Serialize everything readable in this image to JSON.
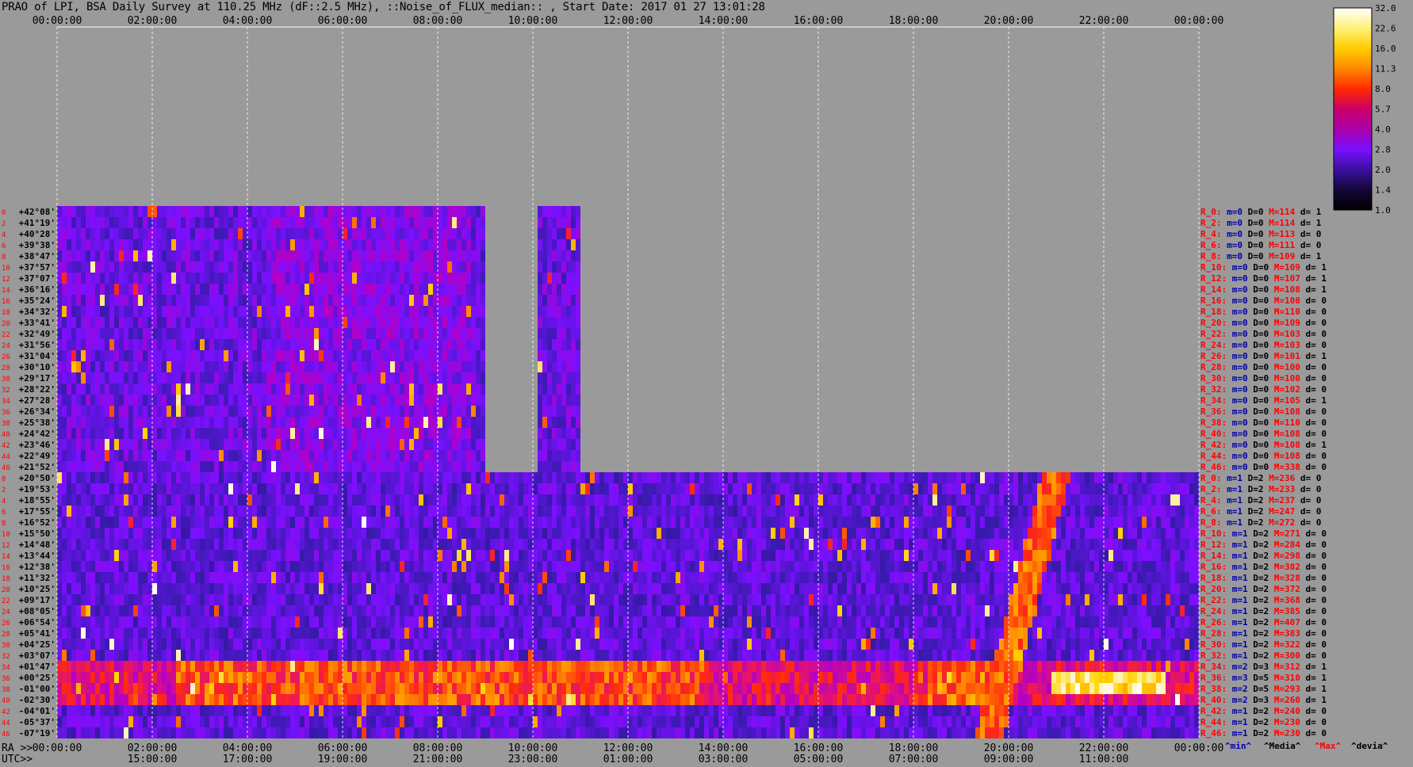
{
  "header": {
    "title": "PRAO of LPI, BSA Daily Survey at 110.25 MHz (dF::2.5 MHz), ::Noise_of_FLUX_median:: , Start Date: 2017 01 27 13:01:28"
  },
  "colorbar": {
    "ticks": [
      "32.0",
      "22.6",
      "16.0",
      "11.3",
      "8.0",
      "5.7",
      "4.0",
      "2.8",
      "2.0",
      "1.4",
      "1.0"
    ],
    "colors": [
      "#ffffff",
      "#fff27a",
      "#ffcc00",
      "#ff8800",
      "#ff2a00",
      "#cc0066",
      "#aa00aa",
      "#7a10ff",
      "#3a10a0",
      "#140638",
      "#000000"
    ]
  },
  "axis_labels": {
    "ra_prefix": "RA >>",
    "utc_prefix": "UTC>>",
    "legend_min": "^min^",
    "legend_media": "^Media^",
    "legend_max": "^Max^",
    "legend_devia": "^devia^"
  },
  "chart_data": {
    "type": "heatmap",
    "title": "PRAO of LPI, BSA Daily Survey at 110.25 MHz (dF::2.5 MHz), ::Noise_of_FLUX_median:: , Start Date: 2017 01 27 13:01:28",
    "x_top_ticks": [
      "00:00:00",
      "02:00:00",
      "04:00:00",
      "06:00:00",
      "08:00:00",
      "10:00:00",
      "12:00:00",
      "14:00:00",
      "16:00:00",
      "18:00:00",
      "20:00:00",
      "22:00:00",
      "00:00:00"
    ],
    "x_bottom_ra_ticks": [
      "00:00:00",
      "02:00:00",
      "04:00:00",
      "06:00:00",
      "08:00:00",
      "10:00:00",
      "12:00:00",
      "14:00:00",
      "16:00:00",
      "18:00:00",
      "20:00:00",
      "22:00:00",
      "00:00:00"
    ],
    "x_bottom_utc_ticks": [
      "15:00:00",
      "17:00:00",
      "19:00:00",
      "21:00:00",
      "23:00:00",
      "01:00:00",
      "03:00:00",
      "05:00:00",
      "07:00:00",
      "09:00:00",
      "11:00:00"
    ],
    "row_numbers": [
      0,
      2,
      4,
      6,
      8,
      10,
      12,
      14,
      16,
      18,
      20,
      22,
      24,
      26,
      28,
      30,
      32,
      34,
      36,
      38,
      40,
      42,
      44,
      46,
      0,
      2,
      4,
      6,
      8,
      10,
      12,
      14,
      16,
      18,
      20,
      22,
      24,
      26,
      28,
      30,
      32,
      34,
      36,
      38,
      40,
      42,
      44,
      46
    ],
    "declinations": [
      "+42°08'",
      "+41°19'",
      "+40°28'",
      "+39°38'",
      "+38°47'",
      "+37°57'",
      "+37°07'",
      "+36°16'",
      "+35°24'",
      "+34°32'",
      "+33°41'",
      "+32°49'",
      "+31°56'",
      "+31°04'",
      "+30°10'",
      "+29°17'",
      "+28°22'",
      "+27°28'",
      "+26°34'",
      "+25°38'",
      "+24°42'",
      "+23°46'",
      "+22°49'",
      "+21°52'",
      "+20°50'",
      "+19°53'",
      "+18°55'",
      "+17°55'",
      "+16°52'",
      "+15°50'",
      "+14°48'",
      "+13°44'",
      "+12°38'",
      "+11°32'",
      "+10°25'",
      "+09°17'",
      "+08°05'",
      "+06°54'",
      "+05°41'",
      "+04°25'",
      "+03°07'",
      "+01°47'",
      "+00°25'",
      "-01°00'",
      "-02°30'",
      "-04°01'",
      "-05°37'",
      "-07°19'"
    ],
    "row_stats": [
      {
        "r": "R_0:",
        "m": "m=0",
        "D": "D=0",
        "M": "M=114",
        "d": "d= 1"
      },
      {
        "r": "R_2:",
        "m": "m=0",
        "D": "D=0",
        "M": "M=114",
        "d": "d= 1"
      },
      {
        "r": "R_4:",
        "m": "m=0",
        "D": "D=0",
        "M": "M=113",
        "d": "d= 0"
      },
      {
        "r": "R_6:",
        "m": "m=0",
        "D": "D=0",
        "M": "M=111",
        "d": "d= 0"
      },
      {
        "r": "R_8:",
        "m": "m=0",
        "D": "D=0",
        "M": "M=109",
        "d": "d= 1"
      },
      {
        "r": "R_10:",
        "m": "m=0",
        "D": "D=0",
        "M": "M=109",
        "d": "d= 1"
      },
      {
        "r": "R_12:",
        "m": "m=0",
        "D": "D=0",
        "M": "M=107",
        "d": "d= 1"
      },
      {
        "r": "R_14:",
        "m": "m=0",
        "D": "D=0",
        "M": "M=108",
        "d": "d= 1"
      },
      {
        "r": "R_16:",
        "m": "m=0",
        "D": "D=0",
        "M": "M=108",
        "d": "d= 0"
      },
      {
        "r": "R_18:",
        "m": "m=0",
        "D": "D=0",
        "M": "M=110",
        "d": "d= 0"
      },
      {
        "r": "R_20:",
        "m": "m=0",
        "D": "D=0",
        "M": "M=109",
        "d": "d= 0"
      },
      {
        "r": "R_22:",
        "m": "m=0",
        "D": "D=0",
        "M": "M=103",
        "d": "d= 0"
      },
      {
        "r": "R_24:",
        "m": "m=0",
        "D": "D=0",
        "M": "M=103",
        "d": "d= 0"
      },
      {
        "r": "R_26:",
        "m": "m=0",
        "D": "D=0",
        "M": "M=101",
        "d": "d= 1"
      },
      {
        "r": "R_28:",
        "m": "m=0",
        "D": "D=0",
        "M": "M=100",
        "d": "d= 0"
      },
      {
        "r": "R_30:",
        "m": "m=0",
        "D": "D=0",
        "M": "M=100",
        "d": "d= 0"
      },
      {
        "r": "R_32:",
        "m": "m=0",
        "D": "D=0",
        "M": "M=102",
        "d": "d= 0"
      },
      {
        "r": "R_34:",
        "m": "m=0",
        "D": "D=0",
        "M": "M=105",
        "d": "d= 1"
      },
      {
        "r": "R_36:",
        "m": "m=0",
        "D": "D=0",
        "M": "M=108",
        "d": "d= 0"
      },
      {
        "r": "R_38:",
        "m": "m=0",
        "D": "D=0",
        "M": "M=110",
        "d": "d= 0"
      },
      {
        "r": "R_40:",
        "m": "m=0",
        "D": "D=0",
        "M": "M=108",
        "d": "d= 0"
      },
      {
        "r": "R_42:",
        "m": "m=0",
        "D": "D=0",
        "M": "M=108",
        "d": "d= 1"
      },
      {
        "r": "R_44:",
        "m": "m=0",
        "D": "D=0",
        "M": "M=108",
        "d": "d= 0"
      },
      {
        "r": "R_46:",
        "m": "m=0",
        "D": "D=0",
        "M": "M=338",
        "d": "d= 0"
      },
      {
        "r": "R_0:",
        "m": "m=1",
        "D": "D=2",
        "M": "M=236",
        "d": "d= 0"
      },
      {
        "r": "R_2:",
        "m": "m=1",
        "D": "D=2",
        "M": "M=233",
        "d": "d= 0"
      },
      {
        "r": "R_4:",
        "m": "m=1",
        "D": "D=2",
        "M": "M=237",
        "d": "d= 0"
      },
      {
        "r": "R_6:",
        "m": "m=1",
        "D": "D=2",
        "M": "M=247",
        "d": "d= 0"
      },
      {
        "r": "R_8:",
        "m": "m=1",
        "D": "D=2",
        "M": "M=272",
        "d": "d= 0"
      },
      {
        "r": "R_10:",
        "m": "m=1",
        "D": "D=2",
        "M": "M=271",
        "d": "d= 0"
      },
      {
        "r": "R_12:",
        "m": "m=1",
        "D": "D=2",
        "M": "M=284",
        "d": "d= 0"
      },
      {
        "r": "R_14:",
        "m": "m=1",
        "D": "D=2",
        "M": "M=298",
        "d": "d= 0"
      },
      {
        "r": "R_16:",
        "m": "m=1",
        "D": "D=2",
        "M": "M=382",
        "d": "d= 0"
      },
      {
        "r": "R_18:",
        "m": "m=1",
        "D": "D=2",
        "M": "M=328",
        "d": "d= 0"
      },
      {
        "r": "R_20:",
        "m": "m=1",
        "D": "D=2",
        "M": "M=372",
        "d": "d= 0"
      },
      {
        "r": "R_22:",
        "m": "m=1",
        "D": "D=2",
        "M": "M=368",
        "d": "d= 0"
      },
      {
        "r": "R_24:",
        "m": "m=1",
        "D": "D=2",
        "M": "M=385",
        "d": "d= 0"
      },
      {
        "r": "R_26:",
        "m": "m=1",
        "D": "D=2",
        "M": "M=407",
        "d": "d= 0"
      },
      {
        "r": "R_28:",
        "m": "m=1",
        "D": "D=2",
        "M": "M=383",
        "d": "d= 0"
      },
      {
        "r": "R_30:",
        "m": "m=1",
        "D": "D=2",
        "M": "M=322",
        "d": "d= 0"
      },
      {
        "r": "R_32:",
        "m": "m=1",
        "D": "D=2",
        "M": "M=300",
        "d": "d= 0"
      },
      {
        "r": "R_34:",
        "m": "m=2",
        "D": "D=3",
        "M": "M=312",
        "d": "d= 1"
      },
      {
        "r": "R_36:",
        "m": "m=3",
        "D": "D=5",
        "M": "M=310",
        "d": "d= 1"
      },
      {
        "r": "R_38:",
        "m": "m=2",
        "D": "D=5",
        "M": "M=293",
        "d": "d= 1"
      },
      {
        "r": "R_40:",
        "m": "m=2",
        "D": "D=3",
        "M": "M=260",
        "d": "d= 1"
      },
      {
        "r": "R_42:",
        "m": "m=1",
        "D": "D=2",
        "M": "M=240",
        "d": "d= 0"
      },
      {
        "r": "R_44:",
        "m": "m=1",
        "D": "D=2",
        "M": "M=230",
        "d": "d= 0"
      },
      {
        "r": "R_46:",
        "m": "m=1",
        "D": "D=2",
        "M": "M=230",
        "d": "d= 0"
      }
    ],
    "colors": {
      "background": "#9a9a9a",
      "stats_label": "#ff0000",
      "stats_min": "#0000aa",
      "stats_max": "#ff0000",
      "row_number": "#ff0000",
      "declination": "#000000",
      "grid": "#ffffff"
    }
  }
}
